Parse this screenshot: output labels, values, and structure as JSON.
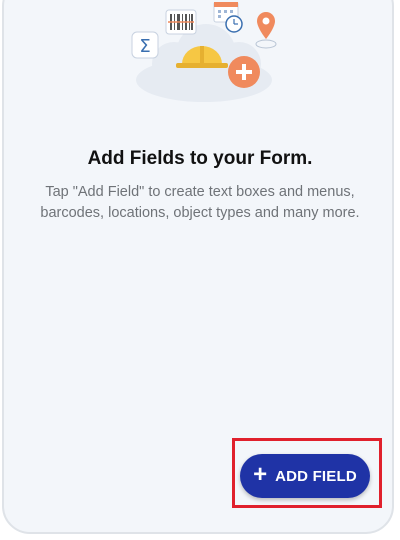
{
  "empty_state": {
    "title": "Add Fields to your Form.",
    "description": "Tap \"Add Field\" to create text boxes and menus, barcodes, locations, object types and many more.",
    "illustration_icons": [
      "sigma-icon",
      "barcode-icon",
      "calendar-icon",
      "clock-icon",
      "location-pin-icon",
      "hard-hat-icon",
      "plus-circle-icon"
    ]
  },
  "fab": {
    "label": "ADD FIELD",
    "icon": "plus-icon"
  },
  "colors": {
    "background": "#f3f6fa",
    "fab": "#1f33a6",
    "highlight": "#e0202c",
    "accent_orange": "#f08a5d",
    "hat_yellow": "#f6c744"
  }
}
